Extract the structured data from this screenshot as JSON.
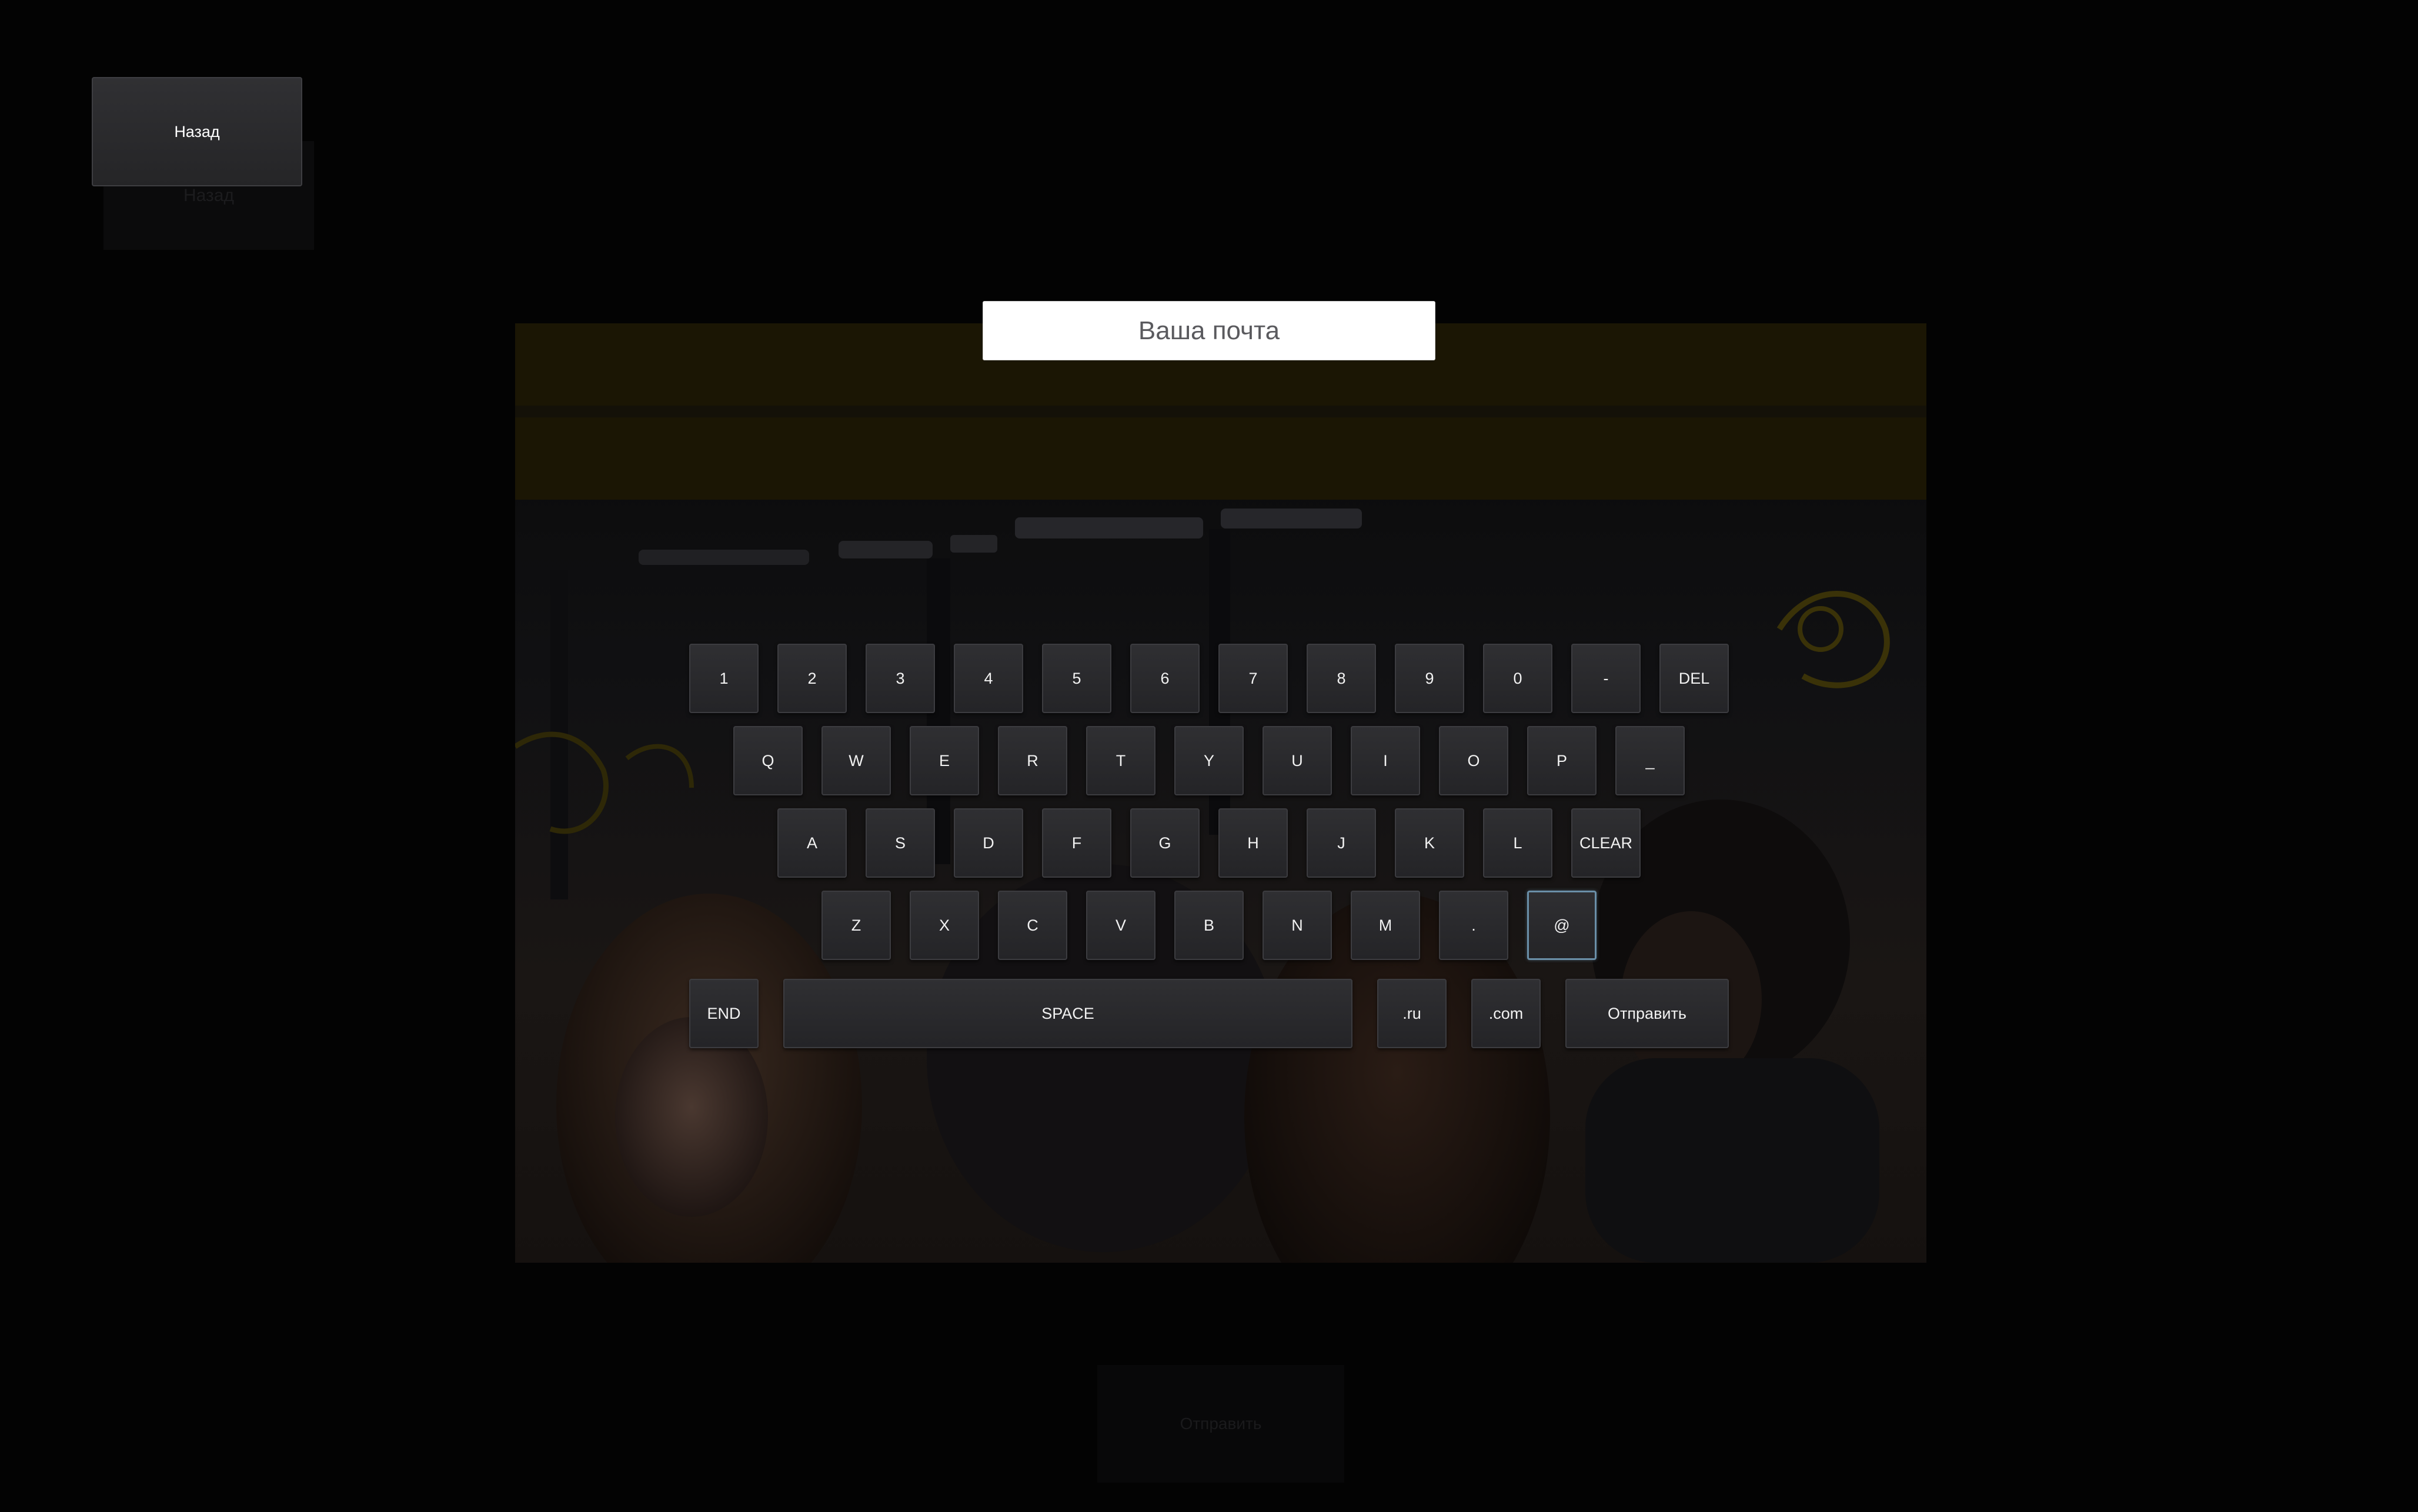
{
  "background": {
    "back_ghost_label": "Назад",
    "send_ghost_label": "Отправить"
  },
  "back_button": {
    "label": "Назад"
  },
  "email_field": {
    "placeholder": "Ваша почта",
    "value": ""
  },
  "keyboard": {
    "focus_color": "#6a8fa8",
    "focused_key": "@",
    "row1": [
      "1",
      "2",
      "3",
      "4",
      "5",
      "6",
      "7",
      "8",
      "9",
      "0",
      "-",
      "DEL"
    ],
    "row2": [
      "Q",
      "W",
      "E",
      "R",
      "T",
      "Y",
      "U",
      "I",
      "O",
      "P",
      "_"
    ],
    "row3": [
      "A",
      "S",
      "D",
      "F",
      "G",
      "H",
      "J",
      "K",
      "L",
      "CLEAR"
    ],
    "row4": [
      "Z",
      "X",
      "C",
      "V",
      "B",
      "N",
      "M",
      ".",
      "@"
    ],
    "row5": {
      "end": "END",
      "space": "SPACE",
      "ru": ".ru",
      "com": ".com",
      "send": "Отправить"
    }
  }
}
